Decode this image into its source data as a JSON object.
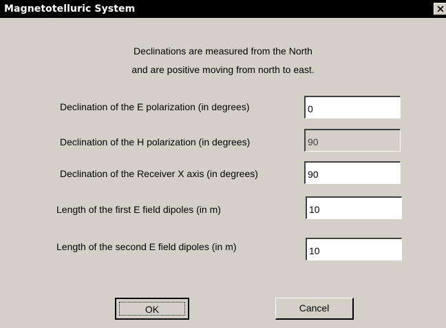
{
  "window": {
    "title": "Magnetotelluric System"
  },
  "note": {
    "line1": "Declinations are measured from the North",
    "line2": "and are positive moving from north to east."
  },
  "fields": {
    "e_polarization": {
      "label": "Declination of the E polarization (in degrees)",
      "value": "0"
    },
    "h_polarization": {
      "label": "Declination of the H polarization (in degrees)",
      "value": "90",
      "disabled": true
    },
    "receiver_x": {
      "label": "Declination of the Receiver X axis (in degrees)",
      "value": "90"
    },
    "first_dipole": {
      "label": "Length of the first E field dipoles (in m)",
      "value": "10"
    },
    "second_dipole": {
      "label": "Length of the second E field dipoles (in m)",
      "value": "10"
    }
  },
  "buttons": {
    "ok": "OK",
    "cancel": "Cancel"
  },
  "icons": {
    "close": "close-icon"
  },
  "colors": {
    "dialog_bg": "#d4d0c8",
    "titlebar_bg": "#000000",
    "titlebar_text": "#ffffff",
    "field_bg": "#ffffff"
  }
}
